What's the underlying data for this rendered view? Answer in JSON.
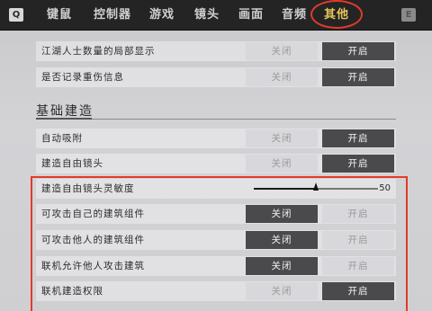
{
  "topbar": {
    "left_key": "Q",
    "right_key": "E",
    "tabs": [
      {
        "label": "键鼠",
        "active": false
      },
      {
        "label": "控制器",
        "active": false
      },
      {
        "label": "游戏",
        "active": false
      },
      {
        "label": "镜头",
        "active": false
      },
      {
        "label": "画面",
        "active": false
      },
      {
        "label": "音频",
        "active": false
      },
      {
        "label": "其他",
        "active": true
      }
    ]
  },
  "rows_top": [
    {
      "label": "江湖人士数量的局部显示",
      "off": "关闭",
      "on": "开启",
      "selected": "on"
    },
    {
      "label": "是否记录重伤信息",
      "off": "关闭",
      "on": "开启",
      "selected": "on"
    }
  ],
  "section": {
    "title": "基础建造"
  },
  "rows_build": [
    {
      "label": "自动吸附",
      "off": "关闭",
      "on": "开启",
      "selected": "on"
    },
    {
      "label": "建造自由镜头",
      "off": "关闭",
      "on": "开启",
      "selected": "on"
    }
  ],
  "slider": {
    "label": "建造自由镜头灵敏度",
    "value": "50",
    "fraction": 0.5
  },
  "rows_highlight": [
    {
      "label": "可攻击自己的建筑组件",
      "off": "关闭",
      "on": "开启",
      "selected": "off"
    },
    {
      "label": "可攻击他人的建筑组件",
      "off": "关闭",
      "on": "开启",
      "selected": "off"
    },
    {
      "label": "联机允许他人攻击建筑",
      "off": "关闭",
      "on": "开启",
      "selected": "off"
    },
    {
      "label": "联机建造权限",
      "off": "关闭",
      "on": "开启",
      "selected": "on"
    }
  ],
  "colors": {
    "accent": "#e8c75a",
    "highlight": "#e23a2a",
    "active_option": "#4a4a4c"
  }
}
